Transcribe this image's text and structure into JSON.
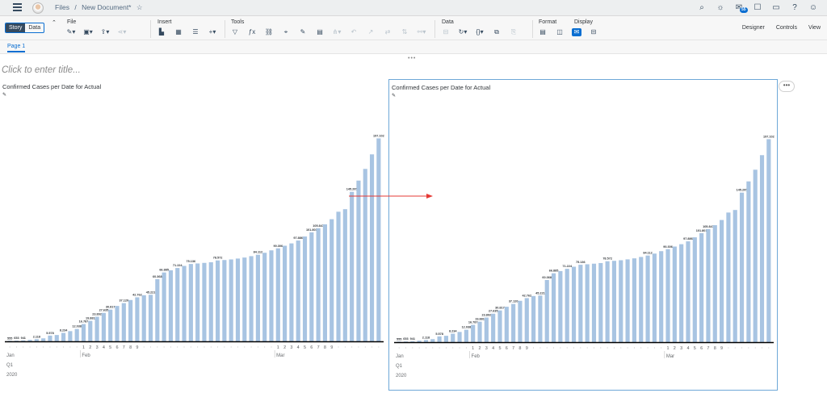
{
  "shell": {
    "breadcrumb": [
      "Files",
      "/",
      "New Document*"
    ],
    "star": "☆",
    "notifications_count": "55",
    "icons": [
      "search-icon",
      "lightbulb-icon",
      "notification-icon",
      "chat-icon",
      "comment-icon",
      "help-icon",
      "user-icon"
    ]
  },
  "toolbar": {
    "story_label": "Story",
    "data_label": "Data",
    "file_label": "File",
    "insert_label": "Insert",
    "tools_label": "Tools",
    "data_group_label": "Data",
    "format_label": "Format",
    "display_label": "Display",
    "designer_label": "Designer",
    "controls_label": "Controls",
    "view_label": "View"
  },
  "page": {
    "tab_label": "Page 1",
    "title_placeholder": "Click to enter title...",
    "grip": "•••",
    "more": "•••"
  },
  "accent_color": "#0a6ed1",
  "bar_color": "#a8c4e2",
  "arrow_color": "#e53935",
  "chart_data": [
    {
      "type": "bar",
      "title": "Confirmed Cases per Date for Actual",
      "x_month_labels": [
        "Jan",
        "Feb",
        "Mar"
      ],
      "x_quarter_label": "Q1",
      "x_year_label": "2020",
      "x_day_ticks_feb": [
        "1",
        "2",
        "3",
        "4",
        "5",
        "6",
        "7",
        "8",
        "9"
      ],
      "x_day_ticks_mar": [
        "1",
        "2",
        "3",
        "4",
        "5",
        "6",
        "7",
        "8",
        "9"
      ],
      "values": [
        555,
        653,
        941,
        1434,
        2118,
        2927,
        5578,
        6166,
        8234,
        9927,
        12038,
        16787,
        19881,
        23892,
        27635,
        30817,
        34391,
        37120,
        40150,
        42762,
        44802,
        45221,
        60368,
        66885,
        69030,
        71224,
        73258,
        75136,
        75639,
        76197,
        76819,
        78572,
        78958,
        79561,
        80406,
        81388,
        82746,
        84112,
        86011,
        88369,
        90306,
        92840,
        95120,
        97886,
        101801,
        105847,
        109821,
        113590,
        118620,
        125875,
        128352,
        145205,
        156101,
        167454,
        181574,
        197102
      ],
      "data_labels": [
        "555",
        "653",
        "941",
        "",
        "2.118",
        "",
        "5.578",
        "",
        "8.234",
        "",
        "12.038",
        "16.787",
        "19.881",
        "23.892",
        "27.635",
        "30.817",
        "",
        "37.120",
        "",
        "42.762",
        "",
        "45.221",
        "60.368",
        "66.885",
        "",
        "71.224",
        "",
        "75.136",
        "",
        "",
        "",
        "78.572",
        "",
        "",
        "",
        "",
        "",
        "84.112",
        "",
        "",
        "90.306",
        "",
        "",
        "97.886",
        "",
        "101.801",
        "105.847",
        "",
        "",
        "",
        "",
        "145.205",
        "",
        "",
        "",
        "197.102"
      ],
      "ylim": [
        0,
        210000
      ]
    },
    {
      "type": "bar",
      "title": "Confirmed Cases per Date for Actual",
      "x_month_labels": [
        "Jan",
        "Feb",
        "Mar"
      ],
      "x_quarter_label": "Q1",
      "x_year_label": "2020",
      "x_day_ticks_feb": [
        "1",
        "2",
        "3",
        "4",
        "5",
        "6",
        "7",
        "8",
        "9"
      ],
      "x_day_ticks_mar": [
        "1",
        "2",
        "3",
        "4",
        "5",
        "6",
        "7",
        "8",
        "9"
      ],
      "values": [
        555,
        653,
        941,
        1434,
        2118,
        2927,
        5578,
        6166,
        8234,
        9927,
        12038,
        16787,
        19881,
        23892,
        27635,
        30817,
        34391,
        37120,
        40150,
        42762,
        44802,
        45221,
        60368,
        66885,
        69030,
        71224,
        73258,
        75136,
        75639,
        76197,
        76819,
        78572,
        78958,
        79561,
        80406,
        81388,
        82746,
        84112,
        86011,
        88369,
        90306,
        92840,
        95120,
        97886,
        101801,
        105847,
        109821,
        113590,
        118620,
        125875,
        128352,
        145205,
        156101,
        167454,
        181574,
        197102
      ],
      "data_labels": [
        "555",
        "653",
        "941",
        "",
        "2.118",
        "",
        "5.578",
        "",
        "8.234",
        "",
        "12.038",
        "16.787",
        "19.881",
        "23.892",
        "27.635",
        "30.817",
        "",
        "37.120",
        "",
        "42.762",
        "",
        "45.221",
        "60.368",
        "66.885",
        "",
        "71.224",
        "",
        "75.136",
        "",
        "",
        "",
        "78.572",
        "",
        "",
        "",
        "",
        "",
        "84.112",
        "",
        "",
        "90.306",
        "",
        "",
        "97.886",
        "",
        "101.801",
        "105.847",
        "",
        "",
        "",
        "",
        "145.205",
        "",
        "",
        "",
        "197.102"
      ],
      "ylim": [
        0,
        210000
      ]
    }
  ]
}
